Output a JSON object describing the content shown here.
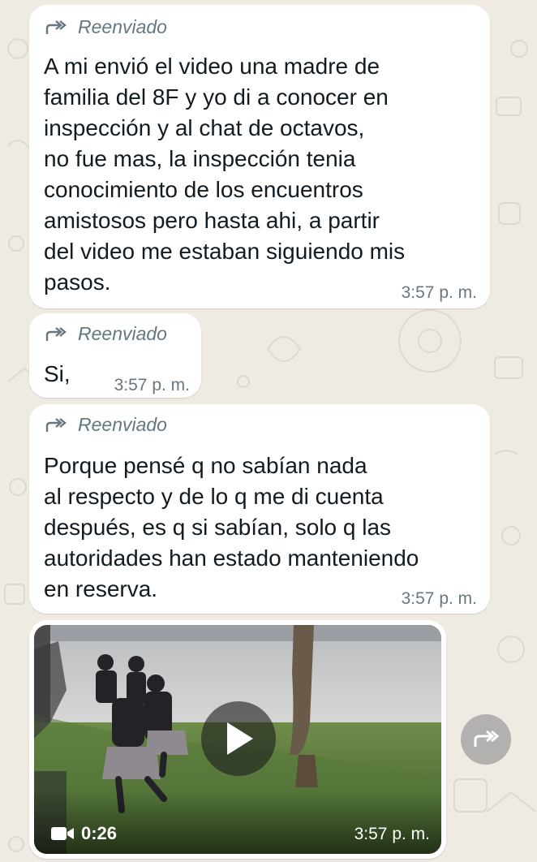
{
  "messages": [
    {
      "forwarded_label": "Reenviado",
      "text": "A mi envió el video una madre de\nfamilia del 8F y yo di a conocer en\ninspección y al chat de octavos,\nno fue mas, la inspección tenia\nconocimiento de los encuentros\namistosos pero hasta ahi, a partir\ndel  video me estaban siguiendo mis\npasos.",
      "time": "3:57 p. m."
    },
    {
      "forwarded_label": "Reenviado",
      "text": "Si,",
      "time": "3:57 p. m."
    },
    {
      "forwarded_label": "Reenviado",
      "text": "Porque pensé q no sabían nada\nal respecto y de lo q me di cuenta\ndespués, es q si sabían, solo q las\nautoridades han estado manteniendo\nen reserva.",
      "time": "3:57 p. m."
    }
  ],
  "video_message": {
    "duration": "0:26",
    "time": "3:57 p. m.",
    "play_icon": "play-icon",
    "camera_icon": "video-camera-icon"
  },
  "share_button": {
    "icon": "forward-icon"
  },
  "colors": {
    "chat_background": "#efeae2",
    "bubble": "#ffffff",
    "meta_text": "#667781",
    "message_text": "#111b21"
  }
}
